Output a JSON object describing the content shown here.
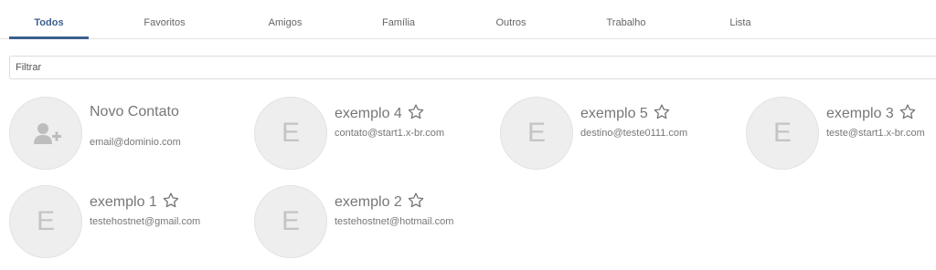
{
  "tabs": [
    {
      "label": "Todos",
      "active": true
    },
    {
      "label": "Favoritos"
    },
    {
      "label": "Amigos"
    },
    {
      "label": "Família"
    },
    {
      "label": "Outros"
    },
    {
      "label": "Trabalho"
    },
    {
      "label": "Lista"
    }
  ],
  "filter": {
    "placeholder": "Filtrar",
    "value": ""
  },
  "new_contact": {
    "name": "Novo Contato",
    "email": "email@dominio.com",
    "icon": "add-user-icon"
  },
  "contacts": [
    {
      "initial": "E",
      "name": "exemplo 4",
      "email": "contato@start1.x-br.com",
      "favorite": false
    },
    {
      "initial": "E",
      "name": "exemplo 5",
      "email": "destino@teste0111.com",
      "favorite": false
    },
    {
      "initial": "E",
      "name": "exemplo 3",
      "email": "teste@start1.x-br.com",
      "favorite": false
    },
    {
      "initial": "E",
      "name": "exemplo 1",
      "email": "testehostnet@gmail.com",
      "favorite": false
    },
    {
      "initial": "E",
      "name": "exemplo 2",
      "email": "testehostnet@hotmail.com",
      "favorite": false
    }
  ],
  "colors": {
    "accent": "#3d5f8e",
    "avatar_bg": "#eeeeee",
    "text": "#777777"
  }
}
